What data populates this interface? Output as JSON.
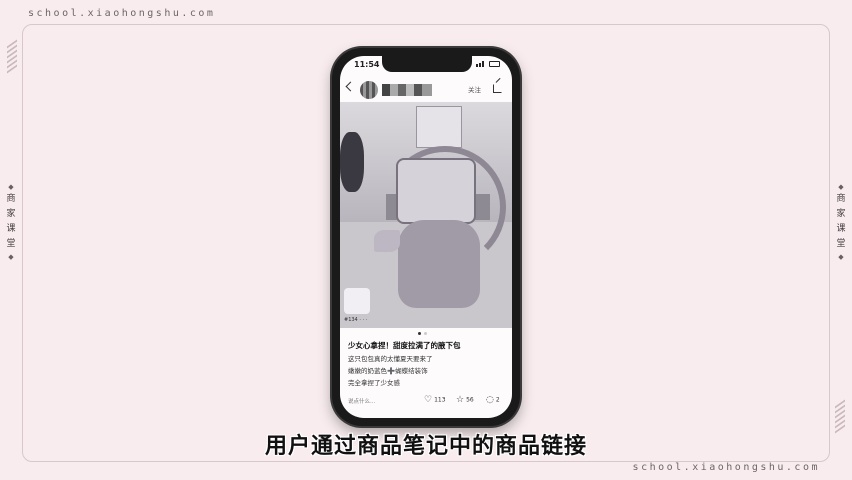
{
  "watermark": {
    "url_top": "school.xiaohongshu.com",
    "url_bottom": "school.xiaohongshu.com"
  },
  "side_tag": {
    "left_chars": [
      "商",
      "家",
      "课",
      "堂"
    ],
    "right_chars": [
      "商",
      "家",
      "课",
      "堂"
    ]
  },
  "phone": {
    "status_time": "11:54",
    "nav": {
      "follow_label": "关注"
    },
    "photo_caption": "#134 · · ·",
    "post": {
      "title": "少女心拿捏！甜度拉满了的腋下包",
      "body_lines": [
        "这只包包真的太懂夏天要来了",
        "嫩嫩的奶蓝色➕蝴蝶结装饰",
        "完全拿捏了少女感"
      ]
    },
    "actions": {
      "comment_placeholder": "说点什么...",
      "likes": "113",
      "stars": "56",
      "comments": "2"
    }
  },
  "subtitle": "用户通过商品笔记中的商品链接"
}
